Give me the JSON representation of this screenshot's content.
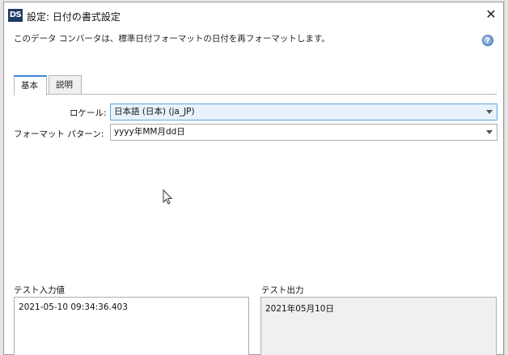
{
  "window": {
    "icon_text": "DS",
    "title": "設定: 日付の書式設定",
    "close_symbol": "✕"
  },
  "description": "このデータ コンバータは、標準日付フォーマットの日付を再フォーマットします。",
  "help_symbol": "?",
  "tabs": [
    {
      "label": "基本",
      "active": true
    },
    {
      "label": "説明",
      "active": false
    }
  ],
  "fields": {
    "locale": {
      "label": "ロケール:",
      "value": "日本語 (日本) (ja_JP)"
    },
    "format_pattern": {
      "label": "フォーマット パターン:",
      "value": "yyyy年MM月dd日"
    }
  },
  "test": {
    "input_label": "テスト入力値",
    "input_value": "2021-05-10 09:34:36.403",
    "output_label": "テスト出力",
    "output_value": "2021年05月10日"
  }
}
